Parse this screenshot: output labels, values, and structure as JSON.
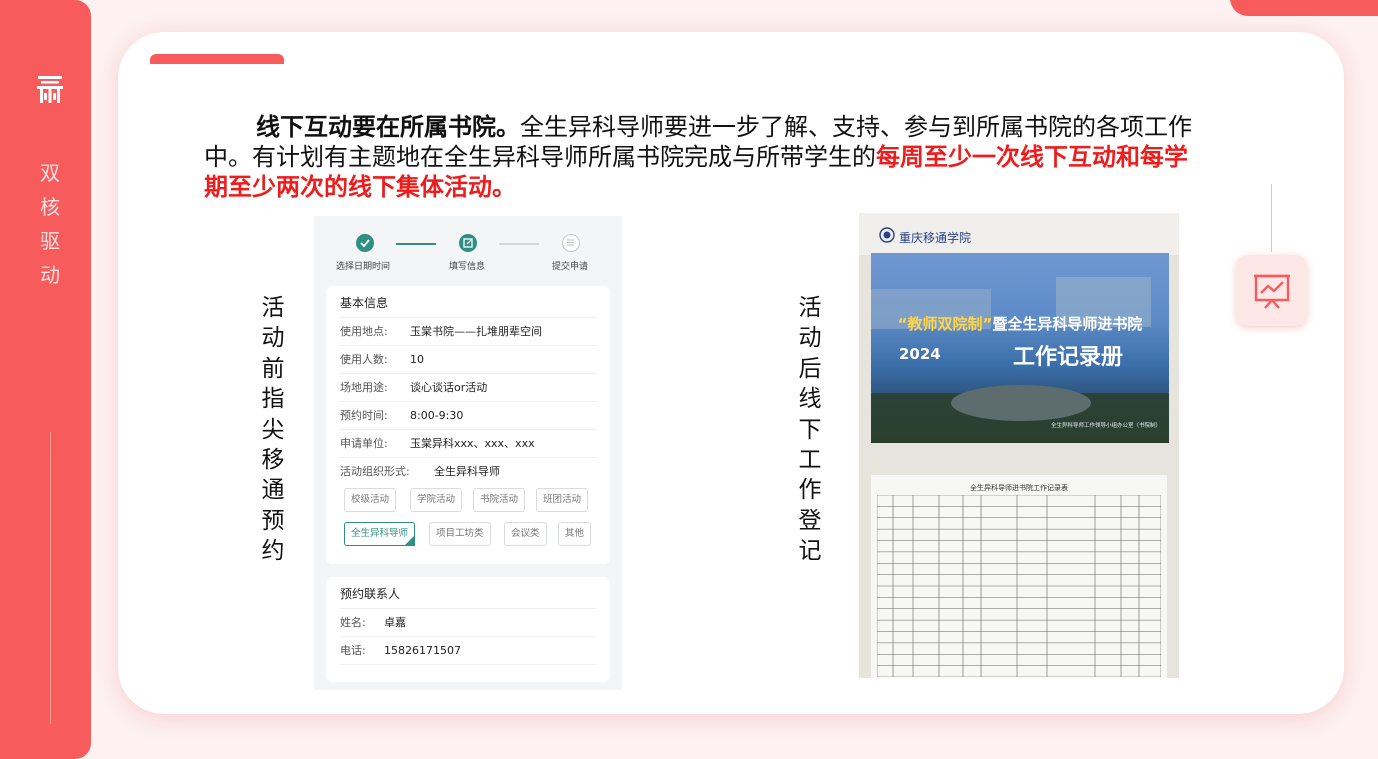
{
  "sidebar": {
    "title_chars": [
      "双",
      "核",
      "驱",
      "动"
    ]
  },
  "paragraph": {
    "lead": "线下互动要在所属书院。",
    "body": "全生异科导师要进一步了解、支持、参与到所属书院的各项工作中。有计划有主题地在全生异科导师所属书院完成与所带学生的",
    "highlight": "每周至少一次线下互动和每学期至少两次的线下集体活动。"
  },
  "captions": {
    "left": [
      "活",
      "动",
      "前",
      "指",
      "尖",
      "移",
      "通",
      "预",
      "约"
    ],
    "right": [
      "活",
      "动",
      "后",
      "线",
      "下",
      "工",
      "作",
      "登",
      "记"
    ]
  },
  "phone_form": {
    "steps": [
      "选择日期时间",
      "填写信息",
      "提交申请"
    ],
    "basic": {
      "title": "基本信息",
      "rows": [
        {
          "k": "使用地点:",
          "v": "玉棠书院——扎堆朋辈空间"
        },
        {
          "k": "使用人数:",
          "v": "10"
        },
        {
          "k": "场地用途:",
          "v": "谈心谈话or活动"
        },
        {
          "k": "预约时间:",
          "v": "8:00-9:30"
        },
        {
          "k": "申请单位:",
          "v": "玉棠异科xxx、xxx、xxx"
        },
        {
          "k": "活动组织形式:",
          "v": "全生异科导师"
        }
      ],
      "chips": [
        "校级活动",
        "学院活动",
        "书院活动",
        "班团活动",
        "全生异科导师",
        "项目工坊类",
        "会议类",
        "其他"
      ],
      "selected_chip": "全生异科导师"
    },
    "contact": {
      "title": "预约联系人",
      "rows": [
        {
          "k": "姓名:",
          "v": "卓嘉"
        },
        {
          "k": "电话:",
          "v": "15826171507"
        }
      ]
    }
  },
  "workbook_photo": {
    "school_name": "重庆移通学院",
    "cover_quote": "“教师双院制”",
    "cover_subtitle": "暨全生异科导师进书院",
    "year": "2024",
    "book_title": "工作记录册",
    "cover_footer": "全生异科导师工作领导小组办公室（书院制）",
    "sheet_title": "全生异科导师进书院工作记录表"
  },
  "colors": {
    "accent": "#f75b5b",
    "highlight": "#ee1d1d",
    "form_teal": "#2f8f82"
  }
}
